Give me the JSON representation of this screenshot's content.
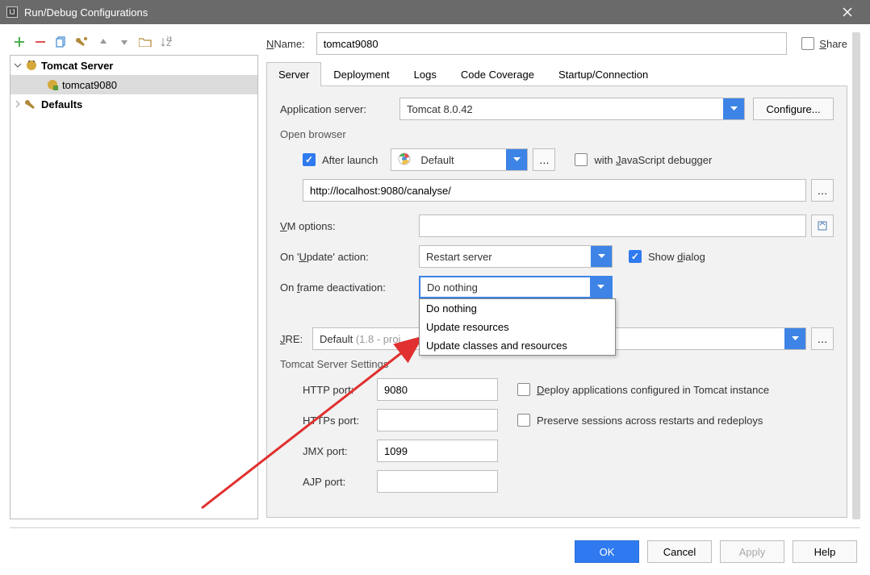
{
  "window": {
    "title": "Run/Debug Configurations"
  },
  "tree": {
    "root_label": "Tomcat Server",
    "child_label": "tomcat9080",
    "defaults_label": "Defaults"
  },
  "name_field": {
    "label": "Name:",
    "value": "tomcat9080"
  },
  "share": {
    "label": "Share"
  },
  "tabs": {
    "items": [
      "Server",
      "Deployment",
      "Logs",
      "Code Coverage",
      "Startup/Connection"
    ],
    "active": 0
  },
  "app_server": {
    "label": "Application server:",
    "value": "Tomcat 8.0.42",
    "configure": "Configure..."
  },
  "open_browser": {
    "section": "Open browser",
    "after_launch_label": "After launch",
    "browser_value": "Default",
    "js_debug_label": "with JavaScript debugger",
    "url_value": "http://localhost:9080/canalyse/"
  },
  "vm_options": {
    "label": "VM options:"
  },
  "update_action": {
    "label": "On 'Update' action:",
    "value": "Restart server",
    "show_dialog": "Show dialog"
  },
  "frame_deact": {
    "label": "On frame deactivation:",
    "value": "Do nothing",
    "options": [
      "Do nothing",
      "Update resources",
      "Update classes and resources"
    ]
  },
  "jre": {
    "label": "JRE:",
    "value_prefix": "Default ",
    "value_gray": "(1.8 - proj"
  },
  "tomcat_settings": {
    "section": "Tomcat Server Settings",
    "http_port": {
      "label": "HTTP port:",
      "value": "9080"
    },
    "https_port": {
      "label": "HTTPs port:",
      "value": ""
    },
    "jmx_port": {
      "label": "JMX port:",
      "value": "1099"
    },
    "ajp_port": {
      "label": "AJP port:",
      "value": ""
    },
    "deploy_chk": "Deploy applications configured in Tomcat instance",
    "preserve_chk": "Preserve sessions across restarts and redeploys"
  },
  "footer": {
    "ok": "OK",
    "cancel": "Cancel",
    "apply": "Apply",
    "help": "Help"
  }
}
